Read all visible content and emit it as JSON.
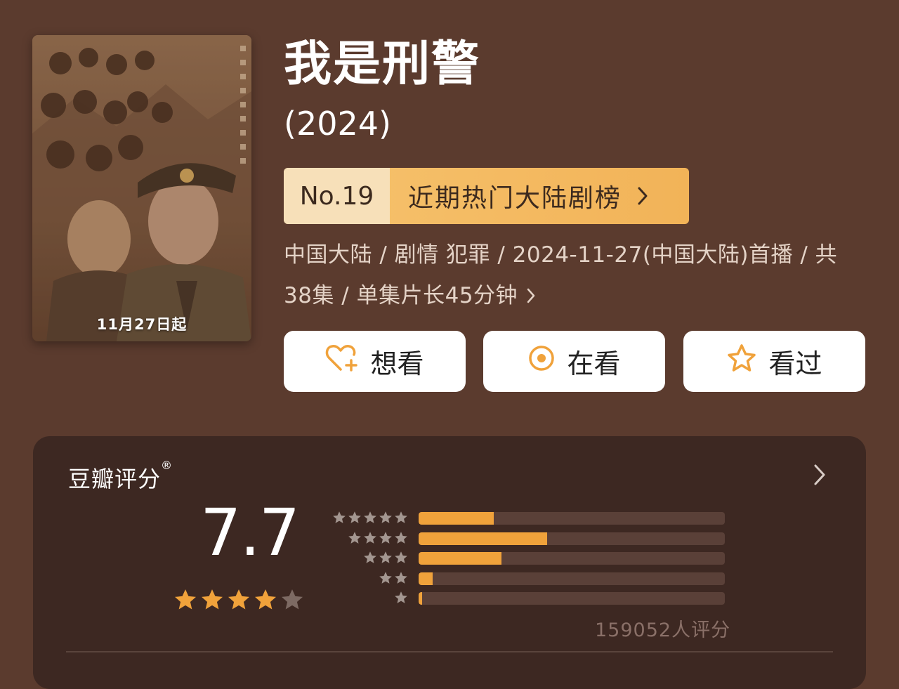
{
  "poster": {
    "date_text": "11月27日起"
  },
  "title": "我是刑警",
  "year": "(2024)",
  "rank": {
    "number": "No.19",
    "list_name": "近期热门大陆剧榜"
  },
  "meta": {
    "line1": "中国大陆 / 剧情 犯罪 / 2024-11-27(中国大陆)首播 / 共",
    "line2": "38集 / 单集片长45分钟"
  },
  "actions": [
    {
      "label": "想看",
      "icon": "heart-plus-icon"
    },
    {
      "label": "在看",
      "icon": "target-circle-icon"
    },
    {
      "label": "看过",
      "icon": "star-outline-icon"
    }
  ],
  "rating": {
    "title": "豆瓣评分",
    "registered_mark": "®",
    "score": "7.7",
    "stars_filled": 4,
    "stars_total": 5,
    "distribution": [
      {
        "stars": 5,
        "fraction": 0.245
      },
      {
        "stars": 4,
        "fraction": 0.42
      },
      {
        "stars": 3,
        "fraction": 0.27
      },
      {
        "stars": 2,
        "fraction": 0.045
      },
      {
        "stars": 1,
        "fraction": 0.012
      }
    ],
    "count_text": "159052人评分"
  },
  "colors": {
    "background": "#5b3b2e",
    "card": "#3d2822",
    "accent": "#f0a23b",
    "rank_gold": "#f2b358"
  }
}
